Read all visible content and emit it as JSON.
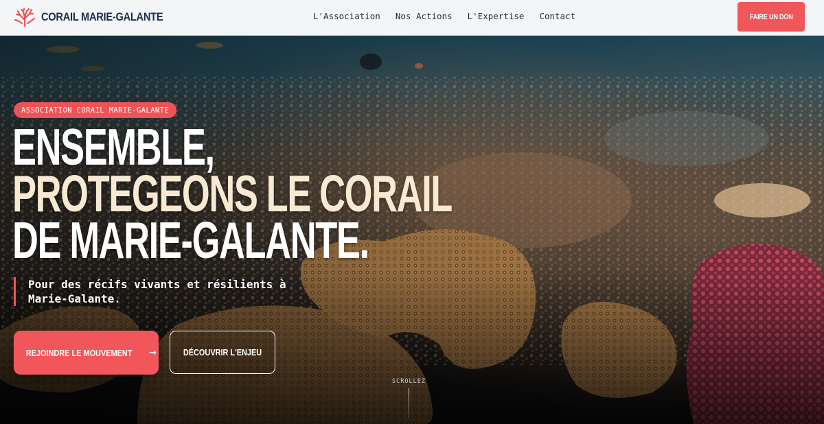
{
  "brand": {
    "name": "CORAIL MARIE-GALANTE",
    "logo_icon": "coral-icon",
    "logo_color": "#ee5357"
  },
  "nav": {
    "items": [
      {
        "label": "L'Association"
      },
      {
        "label": "Nos Actions"
      },
      {
        "label": "L'Expertise"
      },
      {
        "label": "Contact"
      }
    ],
    "donate_label": "FAIRE UN DON"
  },
  "hero": {
    "kicker": "ASSOCIATION CORAIL MARIE-GALANTE",
    "headline": {
      "line1": "ENSEMBLE,",
      "line2": "PROTEGEONS LE CORAIL",
      "line3": "DE MARIE-GALANTE."
    },
    "tagline": "Pour des récifs vivants et résilients à Marie-Galante.",
    "primary_cta": {
      "label": "REJOINDRE LE MOUVEMENT",
      "icon": "arrow-right-icon",
      "glyph": "→"
    },
    "secondary_cta": {
      "label": "DÉCOUVRIR L'ENJEU"
    },
    "scroll_hint": "SCROLLEZ"
  },
  "colors": {
    "accent": "#f0565a",
    "brand_text": "#1d2c4c",
    "headline_accent": "#f8ead2",
    "nav_bg": "#f4f5f6"
  }
}
